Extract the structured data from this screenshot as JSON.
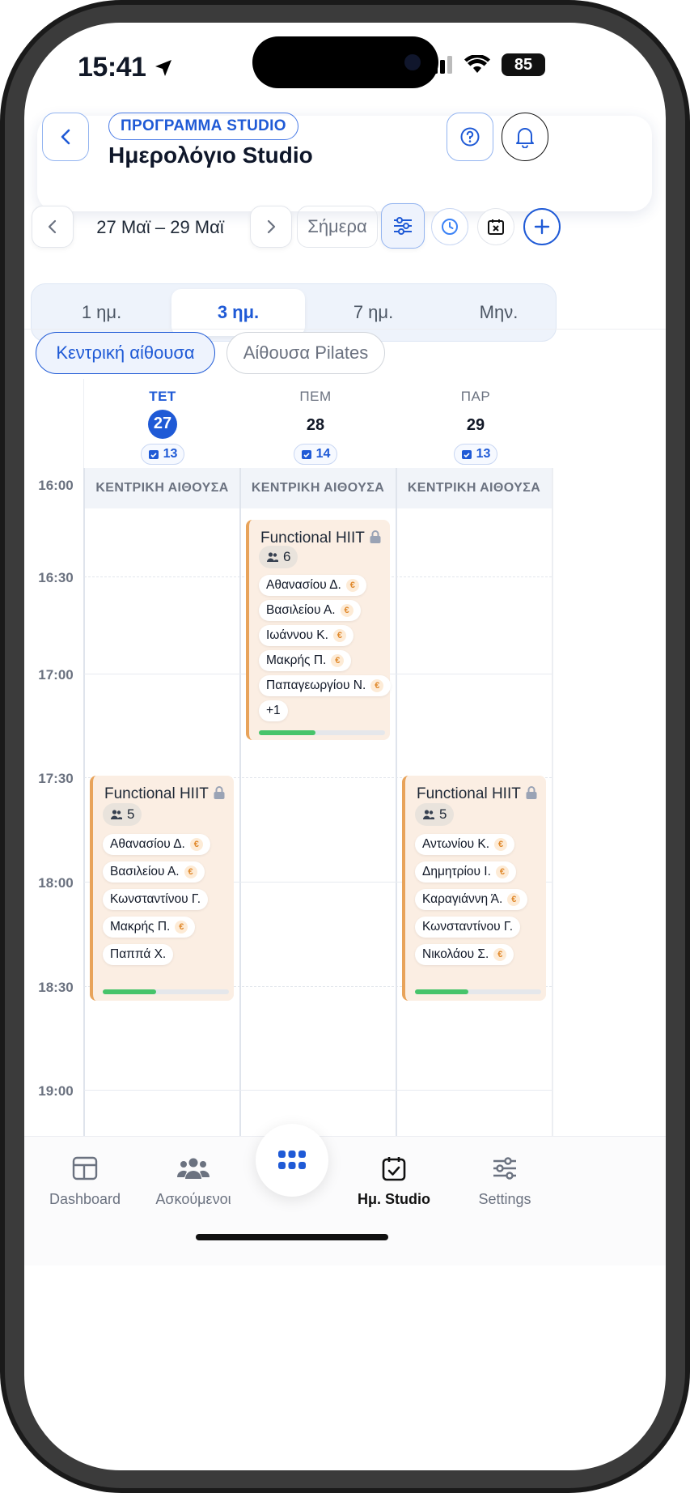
{
  "status_bar": {
    "time": "15:41",
    "battery": "85"
  },
  "header": {
    "tag": "ΠΡΟΓΡΑΜΜΑ STUDIO",
    "title": "Ημερολόγιο Studio"
  },
  "toolbar": {
    "range": "27 Μαϊ – 29 Μαϊ",
    "today_label": "Σήμερα"
  },
  "view_tabs": [
    {
      "label": "1 ημ."
    },
    {
      "label": "3 ημ.",
      "active": true
    },
    {
      "label": "7 ημ."
    },
    {
      "label": "Μην."
    }
  ],
  "rooms": [
    {
      "label": "Κεντρική αίθουσα",
      "active": true
    },
    {
      "label": "Αίθουσα Pilates"
    }
  ],
  "days": [
    {
      "dow": "ΤΕΤ",
      "num": "27",
      "count": "13",
      "active": true,
      "room": "ΚΕΝΤΡΙΚΗ ΑΙΘΟΥΣΑ"
    },
    {
      "dow": "ΠΕΜ",
      "num": "28",
      "count": "14",
      "room": "ΚΕΝΤΡΙΚΗ ΑΙΘΟΥΣΑ"
    },
    {
      "dow": "ΠΑΡ",
      "num": "29",
      "count": "13",
      "room": "ΚΕΝΤΡΙΚΗ ΑΙΘΟΥΣΑ"
    }
  ],
  "times": [
    "16:00",
    "16:30",
    "17:00",
    "17:30",
    "18:00",
    "18:30",
    "19:00"
  ],
  "events": {
    "thu": {
      "title": "Functional HIIT",
      "people": "6",
      "members": [
        "Αθανασίου Δ.",
        "Βασιλείου Α.",
        "Ιωάννου Κ.",
        "Μακρής Π.",
        "Παπαγεωργίου Ν."
      ],
      "more": "+1",
      "progress": 0.45
    },
    "wed": {
      "title": "Functional HIIT",
      "people": "5",
      "members": [
        "Αθανασίου Δ.",
        "Βασιλείου Α.",
        "Κωνσταντίνου Γ.",
        "Μακρής Π.",
        "Παππά Χ."
      ],
      "progress": 0.42
    },
    "fri": {
      "title": "Functional HIIT",
      "people": "5",
      "members": [
        "Αντωνίου Κ.",
        "Δημητρίου Ι.",
        "Καραγιάννη Ά.",
        "Κωνσταντίνου Γ.",
        "Νικολάου Σ."
      ],
      "progress": 0.42
    }
  },
  "tabbar": {
    "dashboard": "Dashboard",
    "members": "Ασκούμενοι",
    "calendar": "Ημ. Studio",
    "settings": "Settings"
  },
  "colors": {
    "accent": "#1f5ad6",
    "event_bg": "#fbeee3",
    "event_border": "#e8a35a",
    "progress": "#47c46b"
  }
}
